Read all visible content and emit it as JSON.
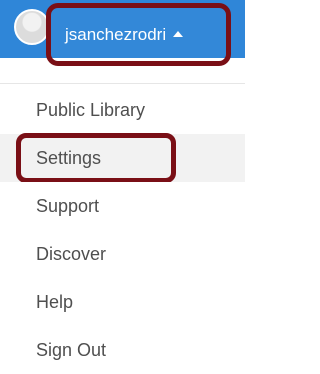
{
  "user": {
    "username": "jsanchezrodri",
    "avatar_icon": "avatar-icon",
    "caret_icon": "caret-up-icon"
  },
  "menu": {
    "items": [
      {
        "label": "Public Library"
      },
      {
        "label": "Settings"
      },
      {
        "label": "Support"
      },
      {
        "label": "Discover"
      },
      {
        "label": "Help"
      },
      {
        "label": "Sign Out"
      }
    ],
    "selected_index": 1
  },
  "colors": {
    "header_blue": "#2f86d8",
    "highlight_red": "#7a0f16",
    "menu_text": "#4f4f4f",
    "selected_bg": "#f2f2f2"
  }
}
